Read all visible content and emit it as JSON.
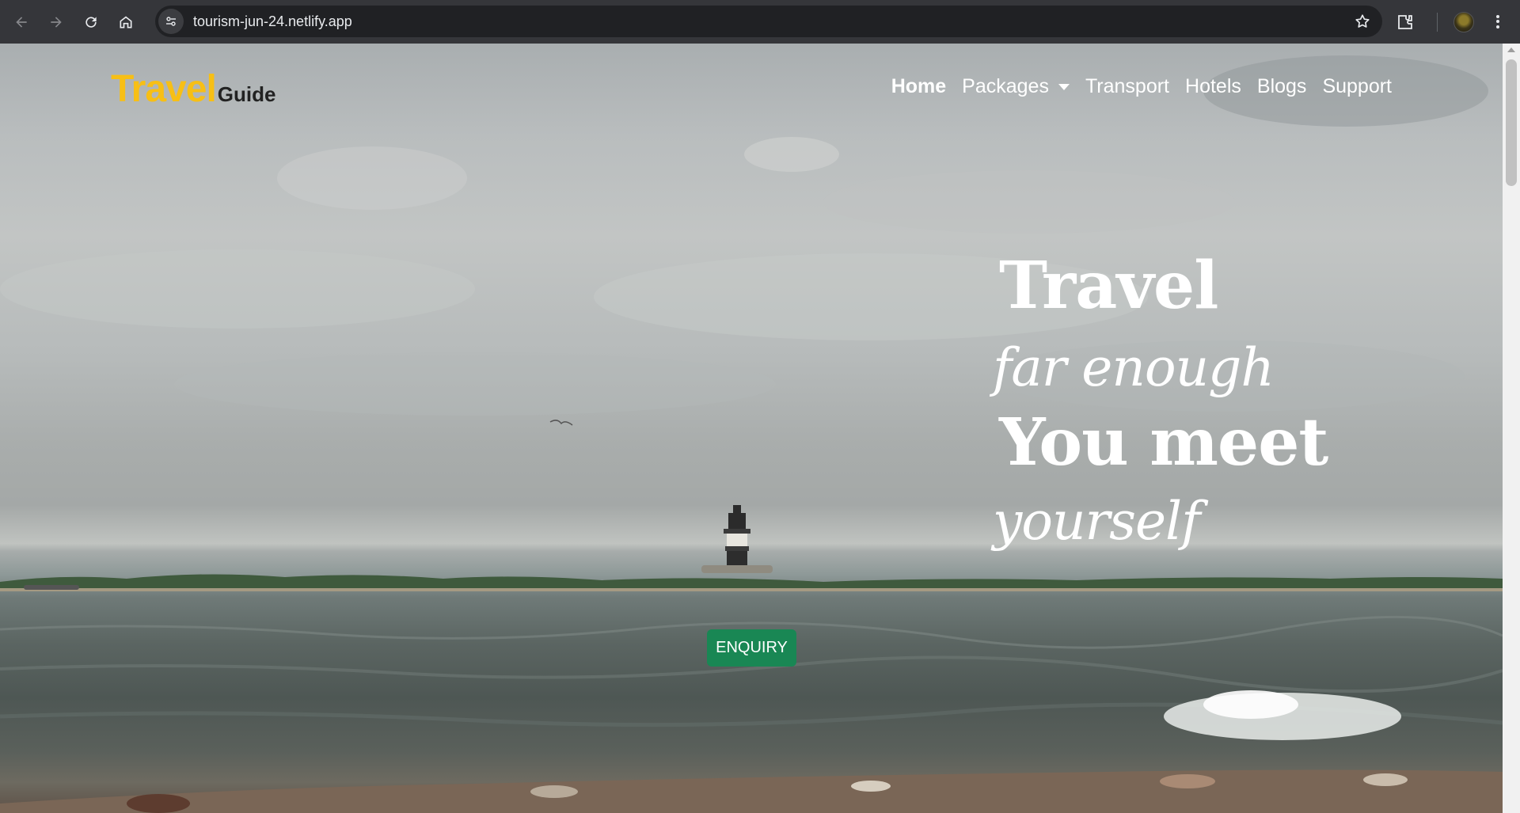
{
  "browser": {
    "url": "tourism-jun-24.netlify.app"
  },
  "site": {
    "logo_main": "Travel",
    "logo_sub": "Guide",
    "logo_main_color": "#f7bf15",
    "nav": {
      "home": "Home",
      "packages": "Packages",
      "transport": "Transport",
      "hotels": "Hotels",
      "blogs": "Blogs",
      "support": "Support"
    },
    "hero": {
      "line1": "Travel",
      "line2": "far enough",
      "line3": "You meet",
      "line4": "yourself"
    },
    "enquiry_label": "ENQUIRY",
    "enquiry_color": "#198754"
  }
}
